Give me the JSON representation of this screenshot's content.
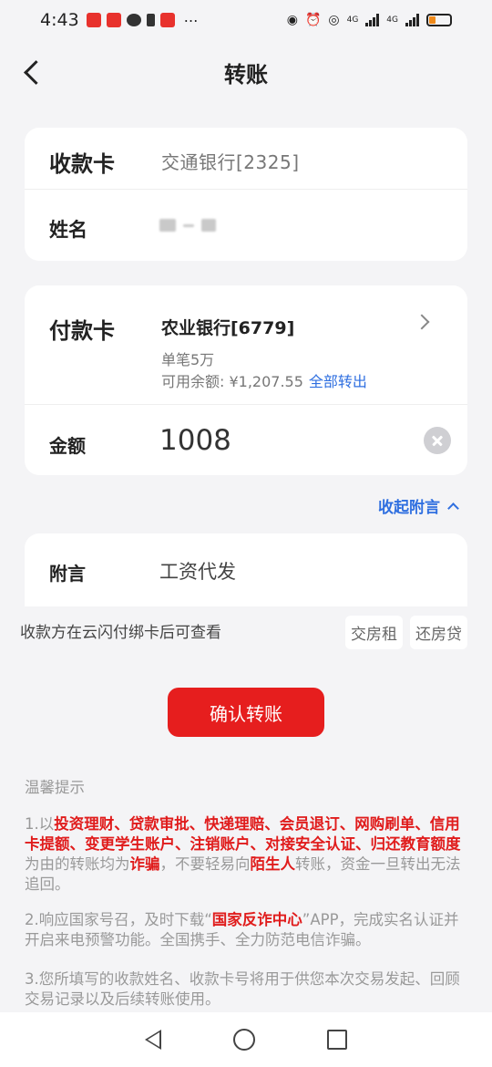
{
  "status_bar": {
    "time": "4:43",
    "icons": [
      "eye-icon",
      "alarm-icon",
      "hotspot-icon",
      "signal-icon",
      "signal-icon",
      "battery-icon"
    ],
    "net1": "4G",
    "net2": "4G"
  },
  "header": {
    "title": "转账"
  },
  "payee": {
    "card_label": "收款卡",
    "card_value": "交通银行[2325]",
    "name_label": "姓名"
  },
  "payer": {
    "card_label": "付款卡",
    "bank": "农业银行[6779]",
    "limit": "单笔5万",
    "available_prefix": "可用余额: ¥1,207.55",
    "transfer_all": "全部转出",
    "amount_label": "金额",
    "amount_value": "1008"
  },
  "collapse_label": "收起附言",
  "memo": {
    "label": "附言",
    "value": "工资代发"
  },
  "note": "收款方在云闪付绑卡后可查看",
  "chips": [
    "交房租",
    "还房贷"
  ],
  "confirm_label": "确认转账",
  "tips": {
    "title": "温馨提示",
    "t1_a": "1.以",
    "t1_red1": "投资理财、贷款审批、快递理赔、会员退订、网购刷单、信用卡提额、变更学生账户、注销账户、对接安全认证、归还教育额度",
    "t1_b": "为由的转账均为",
    "t1_red2": "诈骗",
    "t1_c": "，不要轻易向",
    "t1_red3": "陌生人",
    "t1_d": "转账，资金一旦转出无法追回。",
    "t2_a": "2.响应国家号召，及时下载“",
    "t2_red": "国家反诈中心",
    "t2_b": "”APP，完成实名认证并开启来电预警功能。全国携手、全力防范电信诈骗。",
    "t3": "3.您所填写的收款姓名、收款卡号将用于供您本次交易发起、回顾交易记录以及后续转账使用。"
  }
}
